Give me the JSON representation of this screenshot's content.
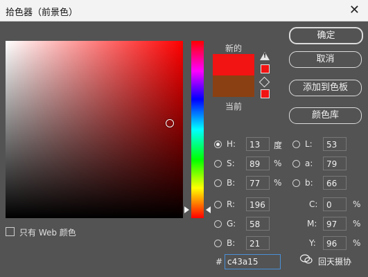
{
  "window": {
    "title": "拾色器（前景色）",
    "close_glyph": "✕"
  },
  "swatches": {
    "new_label": "新的",
    "current_label": "当前",
    "new_color": "#f21313",
    "current_color": "#8a4012"
  },
  "buttons": {
    "ok": "确定",
    "cancel": "取消",
    "add_to_swatches": "添加到色板",
    "color_library": "颜色库"
  },
  "hsb": {
    "h_label": "H:",
    "h_value": "13",
    "h_unit": "度",
    "s_label": "S:",
    "s_value": "89",
    "s_unit": "%",
    "b_label": "B:",
    "b_value": "77",
    "b_unit": "%"
  },
  "lab": {
    "l_label": "L:",
    "l_value": "53",
    "a_label": "a:",
    "a_value": "79",
    "b_label": "b:",
    "b_value": "66"
  },
  "rgb": {
    "r_label": "R:",
    "r_value": "196",
    "g_label": "G:",
    "g_value": "58",
    "b_label": "B:",
    "b_value": "21"
  },
  "cmyk": {
    "c_label": "C:",
    "c_value": "0",
    "c_unit": "%",
    "m_label": "M:",
    "m_value": "97",
    "m_unit": "%",
    "y_label": "Y:",
    "y_value": "96",
    "y_unit": "%"
  },
  "hex": {
    "prefix": "#",
    "value": "c43a15"
  },
  "web_only": {
    "label": "只有 Web 颜色",
    "checked": false
  },
  "watermark": {
    "text": "回天摄协"
  }
}
